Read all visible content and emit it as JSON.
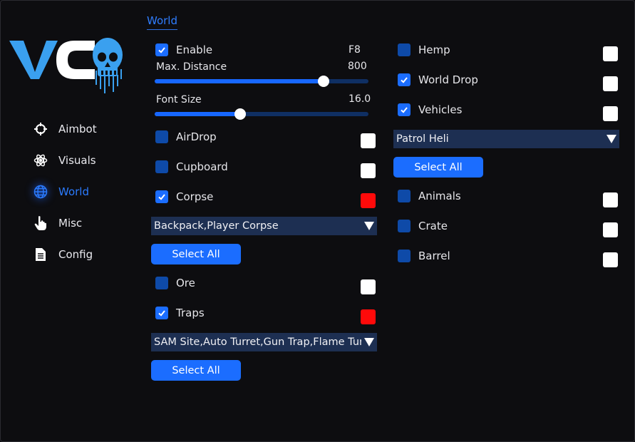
{
  "logo": {
    "text": "VC"
  },
  "sidebar": {
    "items": [
      {
        "label": "Aimbot",
        "icon": "crosshair-icon",
        "active": false
      },
      {
        "label": "Visuals",
        "icon": "atom-icon",
        "active": false
      },
      {
        "label": "World",
        "icon": "globe-icon",
        "active": true
      },
      {
        "label": "Misc",
        "icon": "pointer-hand-icon",
        "active": false
      },
      {
        "label": "Config",
        "icon": "document-icon",
        "active": false
      }
    ]
  },
  "section": {
    "title": "World"
  },
  "left": {
    "enable": {
      "label": "Enable",
      "checked": true,
      "key": "F8"
    },
    "max_distance": {
      "label": "Max. Distance",
      "value": "800",
      "fraction": 0.79
    },
    "font_size": {
      "label": "Font Size",
      "value": "16.0",
      "fraction": 0.4
    },
    "airdrop": {
      "label": "AirDrop",
      "checked": false,
      "color": "#ffffff"
    },
    "cupboard": {
      "label": "Cupboard",
      "checked": false,
      "color": "#ffffff"
    },
    "corpse": {
      "label": "Corpse",
      "checked": true,
      "color": "#ff0a0a"
    },
    "corpse_dropdown": {
      "value": "Backpack,Player Corpse"
    },
    "corpse_select_all": "Select All",
    "ore": {
      "label": "Ore",
      "checked": false,
      "color": "#ffffff"
    },
    "traps": {
      "label": "Traps",
      "checked": true,
      "color": "#ff0a0a"
    },
    "traps_dropdown": {
      "value": "SAM Site,Auto Turret,Gun Trap,Flame Turret"
    },
    "traps_select_all": "Select All"
  },
  "right": {
    "hemp": {
      "label": "Hemp",
      "checked": false,
      "color": "#ffffff"
    },
    "world_drop": {
      "label": "World Drop",
      "checked": true,
      "color": "#ffffff"
    },
    "vehicles": {
      "label": "Vehicles",
      "checked": true,
      "color": "#ffffff"
    },
    "vehicles_dropdown": {
      "value": "Patrol Heli"
    },
    "vehicles_select_all": "Select All",
    "animals": {
      "label": "Animals",
      "checked": false,
      "color": "#ffffff"
    },
    "crate": {
      "label": "Crate",
      "checked": false,
      "color": "#ffffff"
    },
    "barrel": {
      "label": "Barrel",
      "checked": false,
      "color": "#ffffff"
    }
  },
  "colors": {
    "accent": "#1b6dff",
    "unchecked": "#0e4aa8",
    "dropdown": "#1d2f52"
  }
}
